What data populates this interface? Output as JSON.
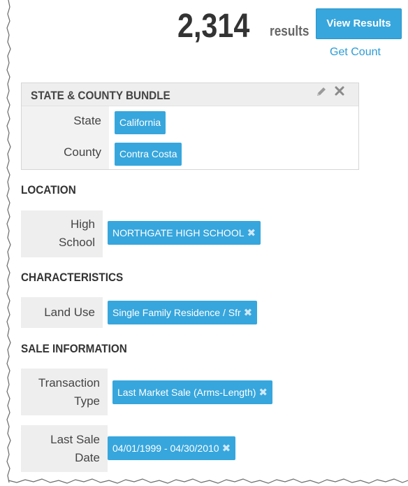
{
  "header": {
    "count": "2,314",
    "count_label": "results",
    "view_results_label": "View Results",
    "get_count_label": "Get Count"
  },
  "bundle": {
    "title": "STATE & COUNTY BUNDLE",
    "rows": [
      {
        "label": "State",
        "value": "California"
      },
      {
        "label": "County",
        "value": "Contra Costa"
      }
    ]
  },
  "sections": {
    "location": {
      "title": "LOCATION",
      "filters": [
        {
          "label_line1": "High",
          "label_line2": "School",
          "value": "NORTHGATE HIGH SCHOOL"
        }
      ]
    },
    "characteristics": {
      "title": "CHARACTERISTICS",
      "filters": [
        {
          "label": "Land Use",
          "value": "Single Family Residence / Sfr"
        }
      ]
    },
    "sale_information": {
      "title": "SALE INFORMATION",
      "filters": [
        {
          "label_line1": "Transaction",
          "label_line2": "Type",
          "value": "Last Market Sale (Arms-Length)"
        },
        {
          "label_line1": "Last Sale",
          "label_line2": "Date",
          "value": "04/01/1999 - 04/30/2010"
        }
      ]
    }
  },
  "icons": {
    "edit": "pencil-icon",
    "close": "close-icon",
    "remove": "remove-x-icon"
  },
  "colors": {
    "accent": "#37a6dd",
    "link": "#2b9bd6",
    "label_bg": "#eeeeee"
  }
}
